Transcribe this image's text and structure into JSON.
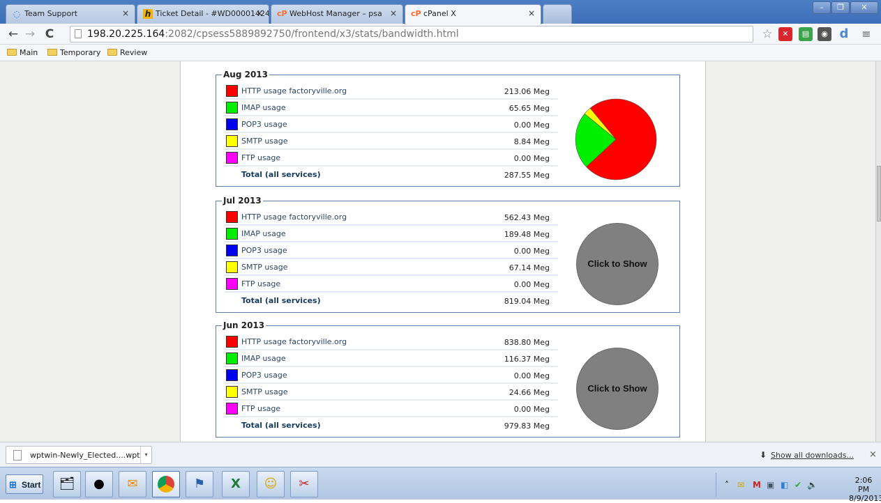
{
  "browser": {
    "tabs": [
      {
        "title": "Team Support",
        "icon": "team-support-icon",
        "active": false
      },
      {
        "title": "Ticket Detail - #WD00001424",
        "icon": "harvest-h-icon",
        "active": false
      },
      {
        "title": "WebHost Manager – psa",
        "icon": "cpanel-icon",
        "active": false
      },
      {
        "title": "cPanel X",
        "icon": "cpanel-icon",
        "active": true
      }
    ],
    "url_host": "198.20.225.164",
    "url_path": ":2082/cpsess5889892750/frontend/x3/stats/bandwidth.html",
    "bookmarks": [
      "Main",
      "Temporary",
      "Review"
    ]
  },
  "months": [
    {
      "legend": "Aug 2013",
      "rows": [
        {
          "label": "HTTP usage factoryville.org",
          "value": "213.06 Meg",
          "color": "#ff0000"
        },
        {
          "label": "IMAP usage",
          "value": "65.65 Meg",
          "color": "#00ee00"
        },
        {
          "label": "POP3 usage",
          "value": "0.00 Meg",
          "color": "#0000ee"
        },
        {
          "label": "SMTP usage",
          "value": "8.84 Meg",
          "color": "#ffff00"
        },
        {
          "label": "FTP usage",
          "value": "0.00 Meg",
          "color": "#ff00ff"
        }
      ],
      "total_label": "Total (all services)",
      "total_value": "287.55 Meg",
      "pie": {
        "shown": true,
        "values": [
          213.06,
          65.65,
          0.0,
          8.84,
          0.0
        ]
      }
    },
    {
      "legend": "Jul 2013",
      "rows": [
        {
          "label": "HTTP usage factoryville.org",
          "value": "562.43 Meg",
          "color": "#ff0000"
        },
        {
          "label": "IMAP usage",
          "value": "189.48 Meg",
          "color": "#00ee00"
        },
        {
          "label": "POP3 usage",
          "value": "0.00 Meg",
          "color": "#0000ee"
        },
        {
          "label": "SMTP usage",
          "value": "67.14 Meg",
          "color": "#ffff00"
        },
        {
          "label": "FTP usage",
          "value": "0.00 Meg",
          "color": "#ff00ff"
        }
      ],
      "total_label": "Total (all services)",
      "total_value": "819.04 Meg",
      "pie": {
        "shown": false,
        "button_label": "Click to Show"
      }
    },
    {
      "legend": "Jun 2013",
      "rows": [
        {
          "label": "HTTP usage factoryville.org",
          "value": "838.80 Meg",
          "color": "#ff0000"
        },
        {
          "label": "IMAP usage",
          "value": "116.37 Meg",
          "color": "#00ee00"
        },
        {
          "label": "POP3 usage",
          "value": "0.00 Meg",
          "color": "#0000ee"
        },
        {
          "label": "SMTP usage",
          "value": "24.66 Meg",
          "color": "#ffff00"
        },
        {
          "label": "FTP usage",
          "value": "0.00 Meg",
          "color": "#ff00ff"
        }
      ],
      "total_label": "Total (all services)",
      "total_value": "979.83 Meg",
      "pie": {
        "shown": false,
        "button_label": "Click to Show"
      }
    }
  ],
  "downloads": {
    "item_name": "wptwin-Newly_Elected....wpt",
    "show_all": "Show all downloads..."
  },
  "taskbar": {
    "start_label": "Start",
    "apps": [
      "file-explorer-icon",
      "firefox-icon",
      "outlook-icon",
      "chrome-icon",
      "network-icon",
      "excel-icon",
      "messenger-icon",
      "snipping-tool-icon"
    ],
    "clock_time": "2:06 PM",
    "clock_date": "8/9/2013"
  }
}
